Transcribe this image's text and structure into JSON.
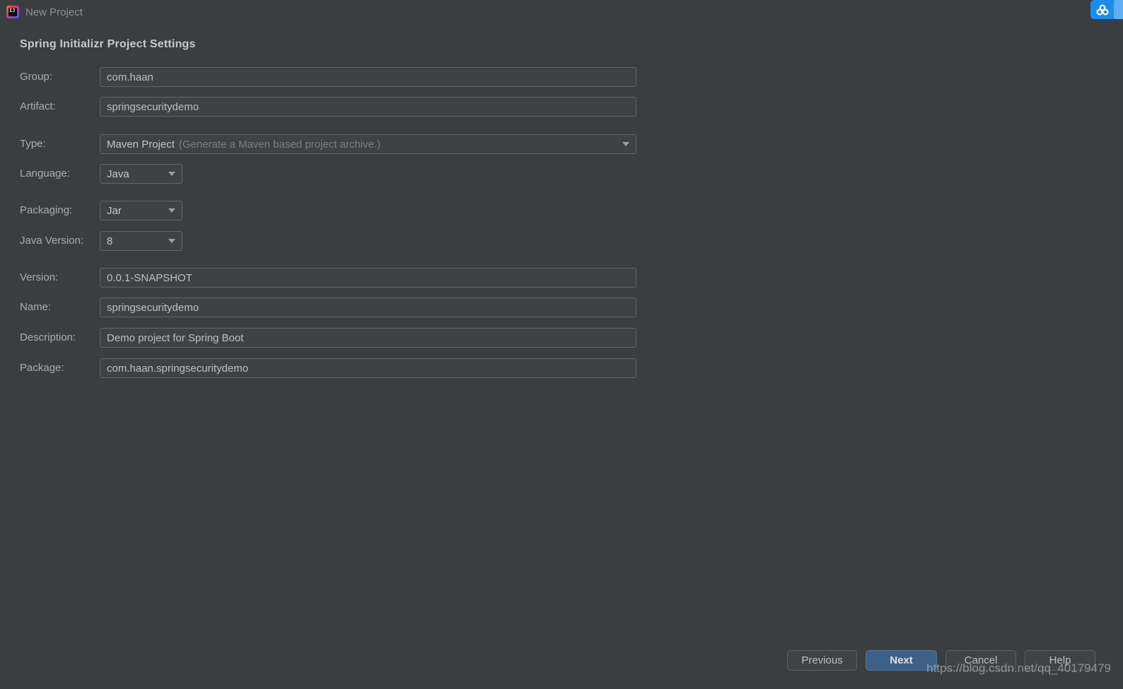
{
  "window": {
    "title": "New Project"
  },
  "icons": {
    "app_icon": "intellij-idea-logo",
    "app_icon_glyph": "IJ",
    "overlay_icon": "baidu-cloud"
  },
  "heading": "Spring Initializr Project Settings",
  "form": {
    "group": {
      "label": "Group:",
      "value": "com.haan"
    },
    "artifact": {
      "label": "Artifact:",
      "value": "springsecuritydemo"
    },
    "type": {
      "label": "Type:",
      "value": "Maven Project",
      "hint": "(Generate a Maven based project archive.)"
    },
    "language": {
      "label": "Language:",
      "value": "Java"
    },
    "packaging": {
      "label": "Packaging:",
      "value": "Jar"
    },
    "java_version": {
      "label": "Java Version:",
      "value": "8"
    },
    "version": {
      "label": "Version:",
      "value": "0.0.1-SNAPSHOT"
    },
    "name": {
      "label": "Name:",
      "value": "springsecuritydemo"
    },
    "description": {
      "label": "Description:",
      "value": "Demo project for Spring Boot"
    },
    "package": {
      "label": "Package:",
      "value": "com.haan.springsecuritydemo"
    }
  },
  "buttons": {
    "previous": "Previous",
    "next": "Next",
    "cancel": "Cancel",
    "help": "Help"
  },
  "watermark": "https://blog.csdn.net/qq_40179479",
  "colors": {
    "window_bg": "#3b3e41",
    "field_border": "#616568",
    "next_button_bg": "#3d6185",
    "widget_blue": "#1d8ce8",
    "widget_blue_light": "#5fb0f2"
  }
}
